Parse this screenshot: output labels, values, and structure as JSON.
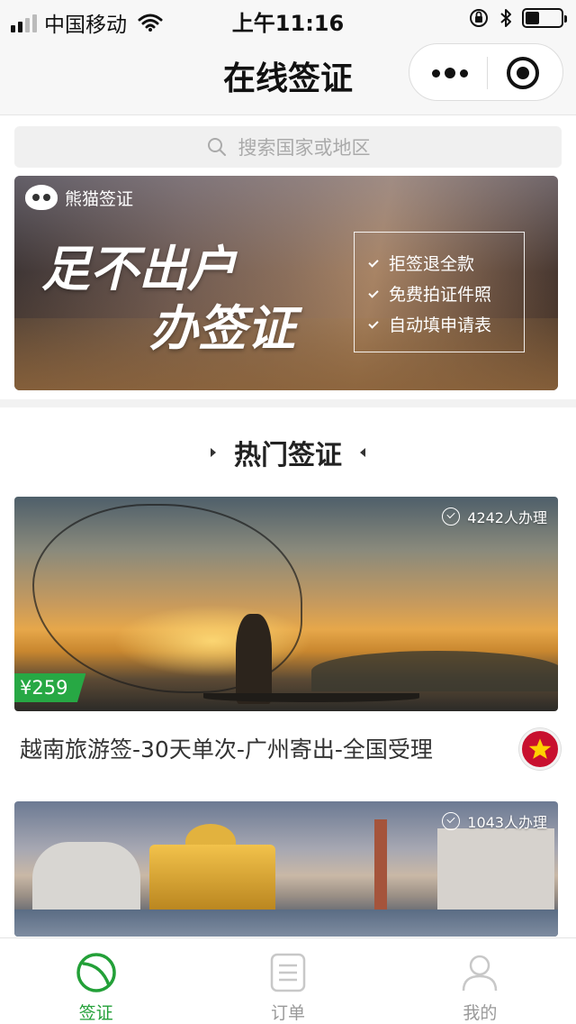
{
  "status_bar": {
    "carrier": "中国移动",
    "time": "上午11:16",
    "battery_level": 0.4
  },
  "nav": {
    "title": "在线签证"
  },
  "search": {
    "placeholder": "搜索国家或地区"
  },
  "banner": {
    "brand": "熊猫签证",
    "slogan_line1": "足不出户",
    "slogan_line2": "办签证",
    "features": [
      "拒签退全款",
      "免费拍证件照",
      "自动填申请表"
    ]
  },
  "section": {
    "title": "热门签证"
  },
  "cards": [
    {
      "count": "4242人办理",
      "price": "¥259",
      "title": "越南旅游签-30天单次-广州寄出-全国受理",
      "flag_icon": "vietnam-flag-icon"
    },
    {
      "count": "1043人办理"
    }
  ],
  "tabs": [
    {
      "label": "签证",
      "icon": "visa-leaf-icon",
      "active": true
    },
    {
      "label": "订单",
      "icon": "order-list-icon",
      "active": false
    },
    {
      "label": "我的",
      "icon": "profile-icon",
      "active": false
    }
  ],
  "colors": {
    "accent": "#23a038",
    "price_tag": "#27a844",
    "flag_red": "#c8102e",
    "flag_star": "#ffd100"
  }
}
